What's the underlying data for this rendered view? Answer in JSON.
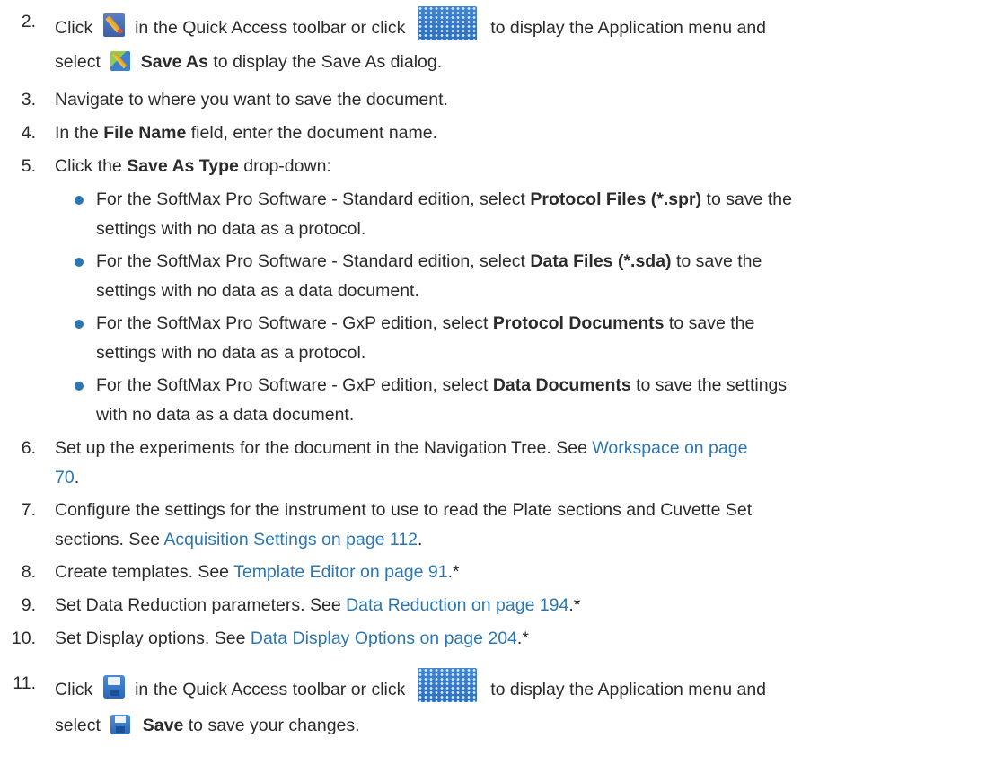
{
  "steps": [
    {
      "num": "2.",
      "parts": [
        "Click",
        "in the Quick Access toolbar or click",
        "to display the Application menu and",
        "select",
        "Save As",
        "to display the Save As dialog."
      ]
    },
    {
      "num": "3.",
      "text": "Navigate to where you want to save the document."
    },
    {
      "num": "4.",
      "pre": "In the ",
      "bold": "File Name",
      "post": " field, enter the document name."
    },
    {
      "num": "5.",
      "pre": "Click the ",
      "bold": "Save As Type",
      "post": " drop-down:"
    },
    {
      "num": "6.",
      "line1": "Set up the experiments for the document in the Navigation Tree. See ",
      "link1": "Workspace on page",
      "link2": "70",
      "post": "."
    },
    {
      "num": "7.",
      "line1": "Configure the settings for the instrument to use to read the Plate sections and Cuvette Set",
      "line2pre": "sections. See ",
      "link": "Acquisition Settings on page 112",
      "post": "."
    },
    {
      "num": "8.",
      "pre": "Create templates. See ",
      "link": "Template Editor on page 91",
      "post": ".*"
    },
    {
      "num": "9.",
      "pre": "Set Data Reduction parameters. See ",
      "link": "Data Reduction on page 194",
      "post": ".*"
    },
    {
      "num": "10.",
      "pre": "Set Display options. See ",
      "link": "Data Display Options on page 204",
      "post": ".*"
    },
    {
      "num": "11.",
      "parts": [
        "Click",
        "in the Quick Access toolbar or click",
        "to display the Application menu and",
        "select",
        "Save",
        "to save your changes."
      ]
    }
  ],
  "bullets": [
    {
      "pre": "For the SoftMax Pro Software - Standard edition, select ",
      "bold": "Protocol Files (*.spr)",
      "post": " to save the",
      "line2": "settings with no data as a protocol."
    },
    {
      "pre": "For the SoftMax Pro Software - Standard edition, select ",
      "bold": "Data Files (*.sda)",
      "post": " to save the",
      "line2": "settings with no data as a data document."
    },
    {
      "pre": "For the SoftMax Pro Software - GxP edition, select ",
      "bold": "Protocol Documents",
      "post": " to save the",
      "line2": "settings with no data as a protocol."
    },
    {
      "pre": "For the SoftMax Pro Software - GxP edition, select ",
      "bold": "Data Documents",
      "post": " to save the settings",
      "line2": "with no data as a data document."
    }
  ],
  "icons": {
    "save_as_toolbar": "save-as-icon",
    "application_menu": "application-menu-icon",
    "save_as_menu": "save-as-menu-icon",
    "save_toolbar": "save-icon",
    "save_menu": "save-menu-icon"
  },
  "colors": {
    "text": "#2b2b2b",
    "link": "#2c77b3",
    "bullet": "#2c77b3"
  }
}
